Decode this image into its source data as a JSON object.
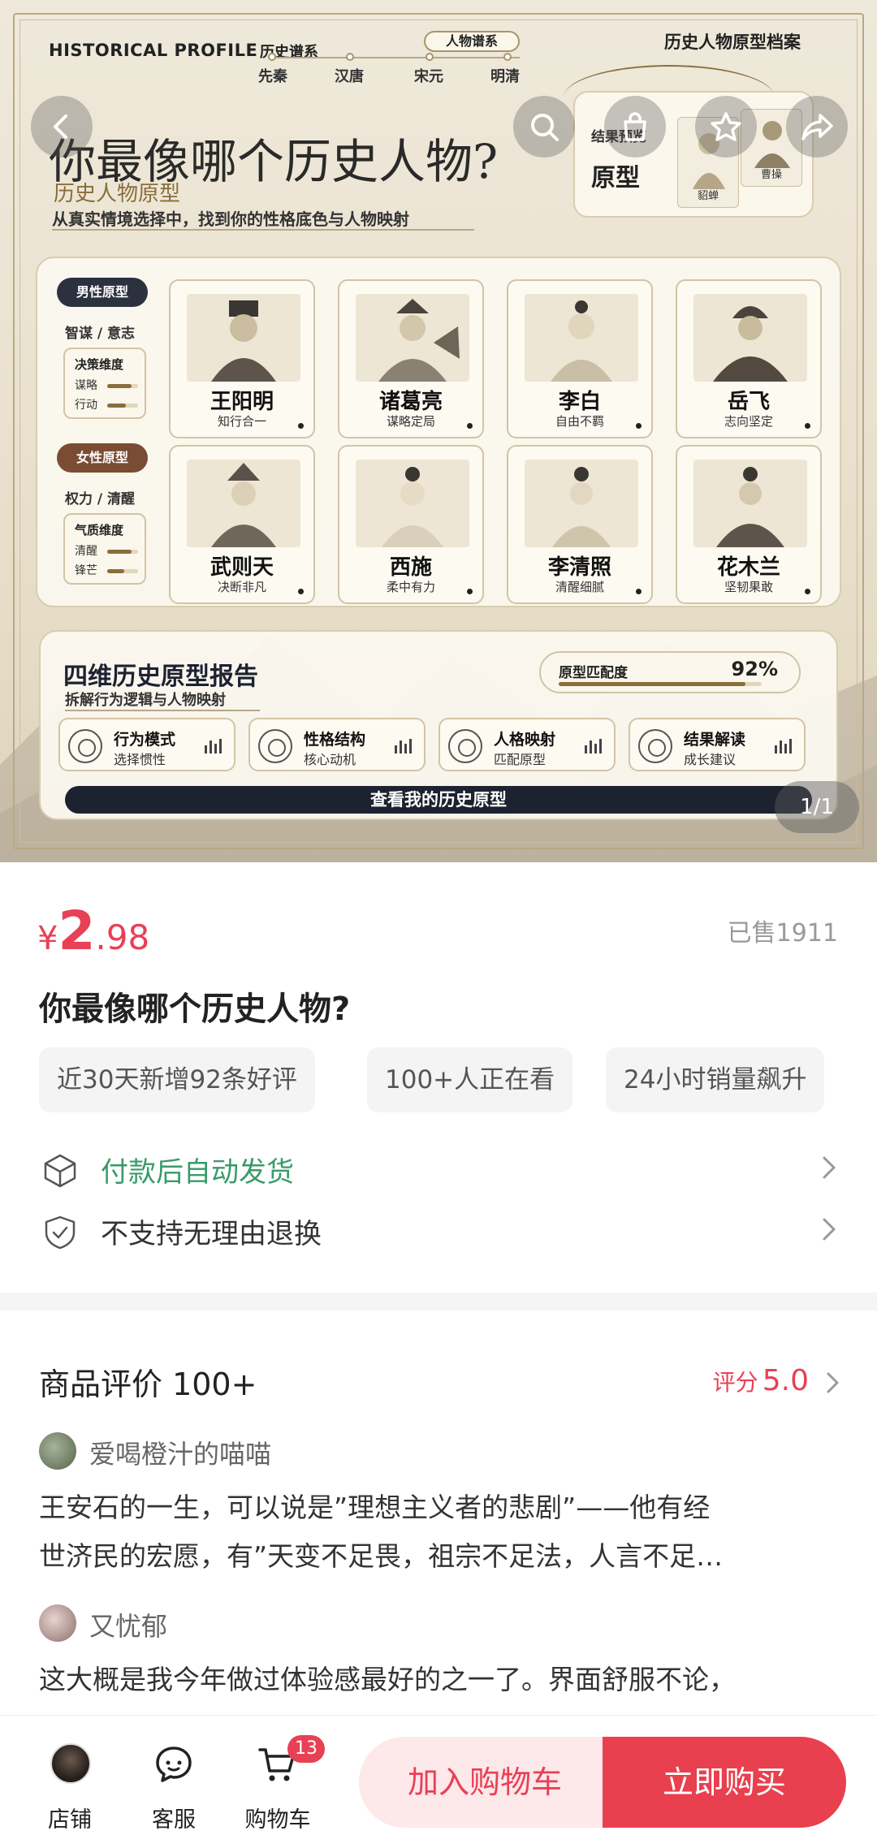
{
  "banner": {
    "title_en": "HISTORICAL PROFILE",
    "timeline_label": "历史谱系",
    "relation_pill": "人物谱系",
    "eras": [
      "先秦",
      "汉唐",
      "宋元",
      "明清"
    ],
    "archive_title": "历史人物原型档案",
    "question": "你最像哪个历史人物?",
    "subtitle": "历史人物原型",
    "tagline": "从真实情境选择中，找到你的性格底色与人物映射",
    "result_card": {
      "line1": "结果预览",
      "line2": "原型",
      "figures": [
        "貂蝉",
        "曹操"
      ]
    },
    "male": {
      "pill": "男性原型",
      "sub": "智谋 / 意志",
      "dim_title": "决策维度",
      "dims": [
        {
          "label": "谋略",
          "level": 0.8
        },
        {
          "label": "行动",
          "level": 0.6
        }
      ]
    },
    "female": {
      "pill": "女性原型",
      "sub": "权力 / 清醒",
      "dim_title": "气质维度",
      "dims": [
        {
          "label": "清醒",
          "level": 0.8
        },
        {
          "label": "锋芒",
          "level": 0.55
        }
      ]
    },
    "characters": [
      {
        "name": "王阳明",
        "desc": "知行合一"
      },
      {
        "name": "诸葛亮",
        "desc": "谋略定局"
      },
      {
        "name": "李白",
        "desc": "自由不羁"
      },
      {
        "name": "岳飞",
        "desc": "志向坚定"
      },
      {
        "name": "武则天",
        "desc": "决断非凡"
      },
      {
        "name": "西施",
        "desc": "柔中有力"
      },
      {
        "name": "李清照",
        "desc": "清醒细腻"
      },
      {
        "name": "花木兰",
        "desc": "坚韧果敢"
      }
    ],
    "report": {
      "title": "四维历史原型报告",
      "sub": "拆解行为逻辑与人物映射",
      "match_label": "原型匹配度",
      "match_value": "92%",
      "match_level": 0.92,
      "tiles": [
        {
          "t1": "行为模式",
          "t2": "选择惯性"
        },
        {
          "t1": "性格结构",
          "t2": "核心动机"
        },
        {
          "t1": "人格映射",
          "t2": "匹配原型"
        },
        {
          "t1": "结果解读",
          "t2": "成长建议"
        }
      ],
      "cta": "查看我的历史原型"
    },
    "page_indicator": "1/1"
  },
  "product": {
    "currency": "¥",
    "price_int": "2",
    "price_dec": ".98",
    "sold": "已售1911",
    "title": "你最像哪个历史人物?",
    "tags": [
      "近30天新增92条好评",
      "100+人正在看",
      "24小时销量飙升"
    ],
    "service1": "付款后自动发货",
    "service2": "不支持无理由退换"
  },
  "reviews": {
    "heading": "商品评价 100+",
    "score_label": "评分",
    "score_value": "5.0",
    "items": [
      {
        "user": "爱喝橙汁的喵喵",
        "line1": "王安石的一生，可以说是”理想主义者的悲剧”——他有经",
        "line2": "世济民的宏愿，有”天变不足畏，祖宗不足法，人言不足…"
      },
      {
        "user": "又忧郁",
        "line1": "这大概是我今年做过体验感最好的之一了。界面舒服不论，",
        "line2": ""
      }
    ]
  },
  "bottom_bar": {
    "shop": "店铺",
    "service": "客服",
    "cart": "购物车",
    "cart_count": "13",
    "add_to_cart": "加入购物车",
    "buy_now": "立即购买"
  },
  "colors": {
    "accent_red": "#e84055",
    "service_green": "#3a9a6a",
    "banner_navy": "#1d2230",
    "banner_gold": "#8a6d3b"
  }
}
